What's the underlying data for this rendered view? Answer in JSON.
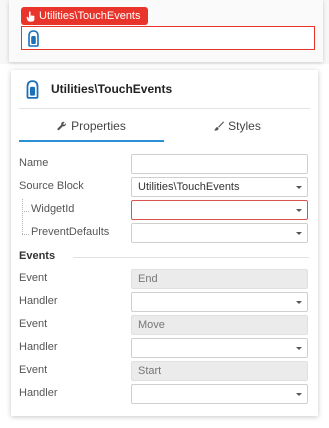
{
  "canvas": {
    "block_label": "Utilities\\TouchEvents",
    "block_icon": "touch-hand-icon"
  },
  "panel": {
    "title": "Utilities\\TouchEvents",
    "icon": "touch-hand-icon",
    "tabs": [
      {
        "label": "Properties",
        "icon": "wrench-icon",
        "active": true
      },
      {
        "label": "Styles",
        "icon": "brush-icon",
        "active": false
      }
    ],
    "fields": {
      "name": {
        "label": "Name",
        "value": ""
      },
      "source_block": {
        "label": "Source Block",
        "value": "Utilities\\TouchEvents"
      },
      "widget_id": {
        "label": "WidgetId",
        "value": ""
      },
      "prevent_defaults": {
        "label": "PreventDefaults",
        "value": ""
      }
    },
    "events_section": "Events",
    "events": [
      {
        "event_label": "Event",
        "event_value": "End",
        "handler_label": "Handler",
        "handler_value": ""
      },
      {
        "event_label": "Event",
        "event_value": "Move",
        "handler_label": "Handler",
        "handler_value": ""
      },
      {
        "event_label": "Event",
        "event_value": "Start",
        "handler_label": "Handler",
        "handler_value": ""
      }
    ]
  },
  "colors": {
    "accent_red": "#e8342a",
    "tab_blue": "#2b8fd6",
    "icon_blue": "#1d6fb8"
  }
}
